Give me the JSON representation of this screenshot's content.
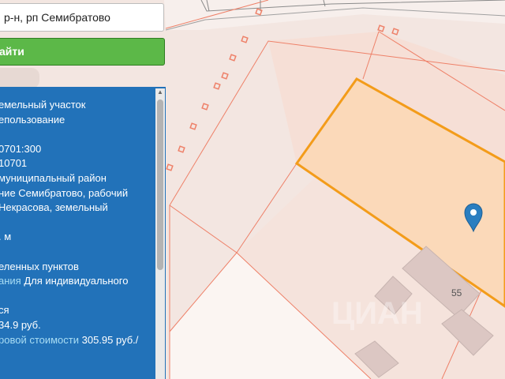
{
  "search": {
    "value": "р-н, рп Семибратово"
  },
  "find_button": {
    "label": "айти"
  },
  "info": {
    "lines": [
      {
        "text": "емельный участок"
      },
      {
        "text": "епользование"
      },
      {
        "text": ""
      },
      {
        "text": "0701:300"
      },
      {
        "text": "10701"
      },
      {
        "text": "муниципальный район"
      },
      {
        "text": "ние Семибратово, рабочий"
      },
      {
        "text": " Некрасова, земельный"
      },
      {
        "text": ""
      },
      {
        "text": ". м"
      },
      {
        "text": ""
      },
      {
        "text": "еленных пунктов"
      },
      {
        "label": "ания",
        "text": " Для индивидуального"
      },
      {
        "text": ""
      },
      {
        "text": "ся"
      },
      {
        "text": "34.9 руб."
      },
      {
        "label": "ровой стоимости",
        "text": " 305.95 руб./"
      }
    ]
  },
  "map": {
    "house_number": "55",
    "watermark": "ЦИАН",
    "colors": {
      "parcel_fill": "#fbd9b9",
      "parcel_stroke": "#f39c1a",
      "pin": "#2a7ec0",
      "background": "#f3e6e1",
      "lines": "#ee8068"
    }
  }
}
